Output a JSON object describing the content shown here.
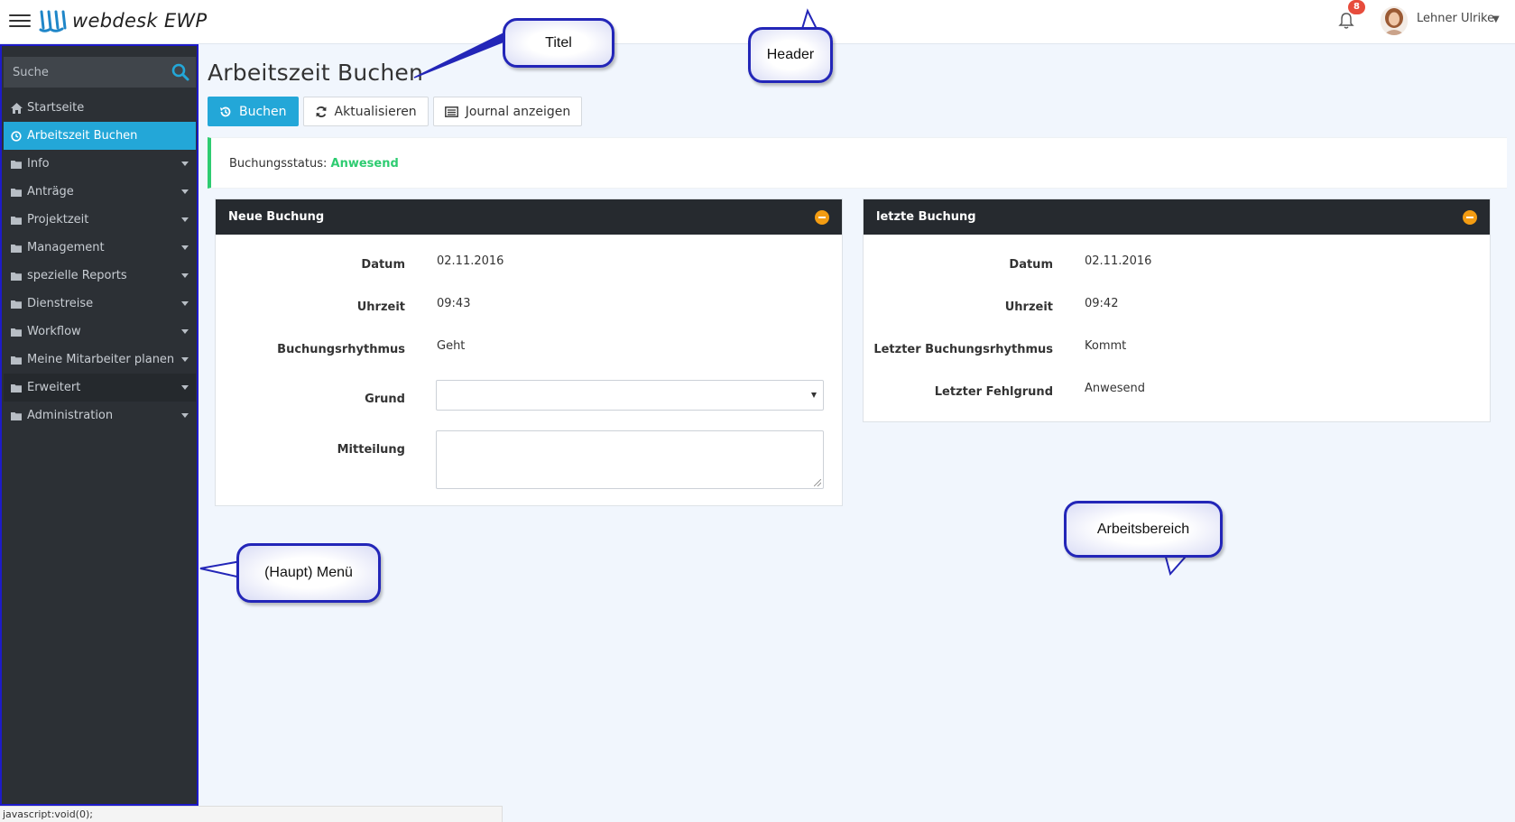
{
  "header": {
    "logo_text": "webdesk EWP",
    "notification_count": "8",
    "user_name": "Lehner Ulrike"
  },
  "sidebar": {
    "search_placeholder": "Suche",
    "items": [
      {
        "label": "Startseite",
        "icon": "home-icon",
        "caret": false
      },
      {
        "label": "Arbeitszeit Buchen",
        "icon": "clock-icon",
        "caret": false,
        "active": true
      },
      {
        "label": "Info",
        "icon": "folder-icon",
        "caret": true
      },
      {
        "label": "Anträge",
        "icon": "folder-icon",
        "caret": true
      },
      {
        "label": "Projektzeit",
        "icon": "folder-icon",
        "caret": true
      },
      {
        "label": "Management",
        "icon": "folder-icon",
        "caret": true
      },
      {
        "label": "spezielle Reports",
        "icon": "folder-icon",
        "caret": true
      },
      {
        "label": "Dienstreise",
        "icon": "folder-icon",
        "caret": true
      },
      {
        "label": "Workflow",
        "icon": "folder-icon",
        "caret": true
      },
      {
        "label": "Meine Mitarbeiter planen",
        "icon": "folder-icon",
        "caret": true
      },
      {
        "label": "Erweitert",
        "icon": "folder-icon",
        "caret": true
      },
      {
        "label": "Administration",
        "icon": "folder-icon",
        "caret": true
      }
    ]
  },
  "main": {
    "title": "Arbeitszeit Buchen",
    "toolbar": {
      "buchen_label": "Buchen",
      "aktualisieren_label": "Aktualisieren",
      "journal_label": "Journal anzeigen"
    },
    "status": {
      "label": "Buchungsstatus:",
      "value": "Anwesend",
      "color": "#2ecc71"
    },
    "neue_buchung": {
      "title": "Neue Buchung",
      "datum_label": "Datum",
      "datum_value": "02.11.2016",
      "uhrzeit_label": "Uhrzeit",
      "uhrzeit_value": "09:43",
      "rhythmus_label": "Buchungsrhythmus",
      "rhythmus_value": "Geht",
      "grund_label": "Grund",
      "grund_value": "",
      "mitteilung_label": "Mitteilung",
      "mitteilung_value": ""
    },
    "letzte_buchung": {
      "title": "letzte Buchung",
      "datum_label": "Datum",
      "datum_value": "02.11.2016",
      "uhrzeit_label": "Uhrzeit",
      "uhrzeit_value": "09:42",
      "rhythmus_label": "Letzter Buchungsrhythmus",
      "rhythmus_value": "Kommt",
      "fehlgrund_label": "Letzter Fehlgrund",
      "fehlgrund_value": "Anwesend"
    }
  },
  "callouts": {
    "titel": "Titel",
    "header": "Header",
    "menu": "(Haupt) Menü",
    "arbeitsbereich": "Arbeitsbereich"
  },
  "statusbar_text": "javascript:void(0);",
  "colors": {
    "accent": "#23a7d8",
    "sidebar_bg": "#2c3035",
    "panel_header": "#262a2f",
    "badge": "#e74c3c",
    "collapse": "#f39c12",
    "callout_border": "#2326b8"
  }
}
